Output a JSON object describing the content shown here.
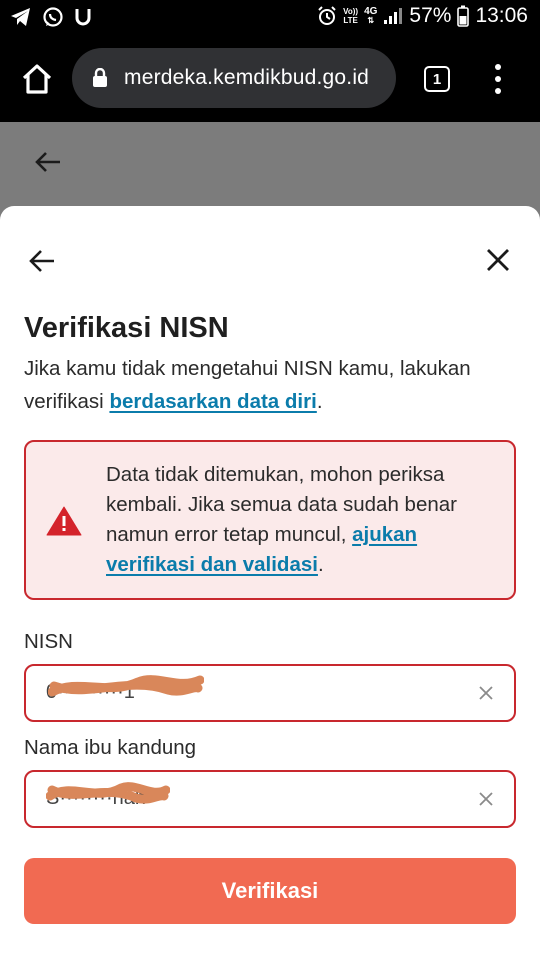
{
  "status_bar": {
    "network_top": "Vo))",
    "network_bottom": "LTE",
    "signal_label": "4G",
    "battery": "57%",
    "time": "13:06",
    "left_icons": [
      "telegram-icon",
      "whatsapp-icon",
      "u-icon"
    ]
  },
  "browser": {
    "url": "merdeka.kemdikbud.go.id",
    "tab_count": "1"
  },
  "sheet": {
    "title": "Verifikasi NISN",
    "description_prefix": "Jika kamu tidak mengetahui NISN kamu, lakukan verifikasi ",
    "description_link": "berdasarkan data diri",
    "description_suffix": ".",
    "alert": {
      "text_prefix": "Data tidak ditemukan, mohon periksa kembali. Jika semua data sudah benar namun error tetap muncul, ",
      "link": "ajukan verifikasi dan validasi",
      "text_suffix": "."
    },
    "nisn": {
      "label": "NISN",
      "value": "0··········1"
    },
    "mother": {
      "label": "Nama ibu kandung",
      "value": "S········nah"
    },
    "submit_label": "Verifikasi"
  },
  "colors": {
    "accent_link": "#0b7cab",
    "error": "#c8282e",
    "button": "#f16a52",
    "redaction": "#d9875a"
  }
}
